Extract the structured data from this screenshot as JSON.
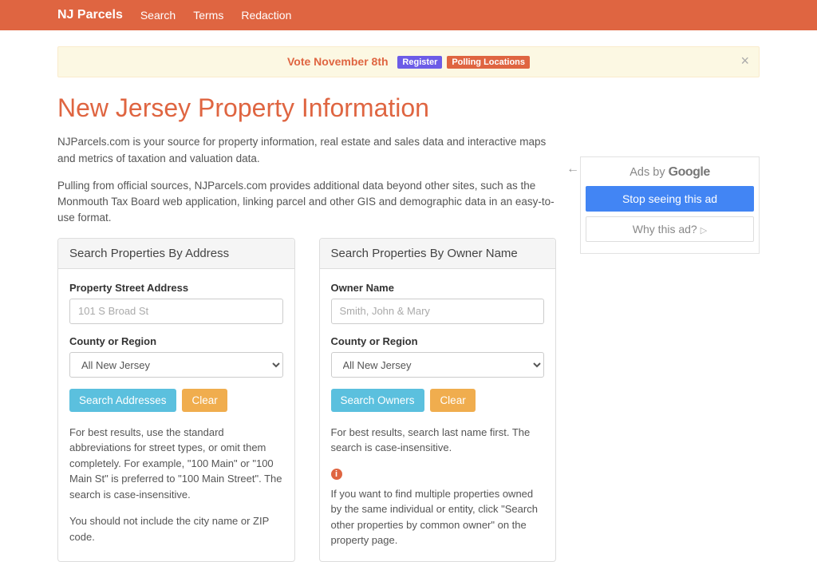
{
  "nav": {
    "brand": "NJ Parcels",
    "links": {
      "search": "Search",
      "terms": "Terms",
      "redaction": "Redaction"
    }
  },
  "alert": {
    "text": "Vote November 8th",
    "register": "Register",
    "polling": "Polling Locations",
    "close": "×"
  },
  "page": {
    "title": "New Jersey Property Information",
    "intro1": "NJParcels.com is your source for property information, real estate and sales data and interactive maps and metrics of taxation and valuation data.",
    "intro2": "Pulling from official sources, NJParcels.com provides additional data beyond other sites, such as the Monmouth Tax Board web application, linking parcel and other GIS and demographic data in an easy-to-use format."
  },
  "addressPanel": {
    "heading": "Search Properties By Address",
    "addressLabel": "Property Street Address",
    "addressPlaceholder": "101 S Broad St",
    "countyLabel": "County or Region",
    "countySelected": "All New Jersey",
    "searchBtn": "Search Addresses",
    "clearBtn": "Clear",
    "help1": "For best results, use the standard abbreviations for street types, or omit them completely. For example, \"100 Main\" or \"100 Main St\" is preferred to \"100 Main Street\". The search is case-insensitive.",
    "help2": "You should not include the city name or ZIP code."
  },
  "ownerPanel": {
    "heading": "Search Properties By Owner Name",
    "ownerLabel": "Owner Name",
    "ownerPlaceholder": "Smith, John & Mary",
    "countyLabel": "County or Region",
    "countySelected": "All New Jersey",
    "searchBtn": "Search Owners",
    "clearBtn": "Clear",
    "help1": "For best results, search last name first. The search is case-insensitive.",
    "help2": "If you want to find multiple properties owned by the same individual or entity, click \"Search other properties by common owner\" on the property page."
  },
  "ad": {
    "byline": "Ads by ",
    "google": "Google",
    "stop": "Stop seeing this ad",
    "why": "Why this ad?"
  }
}
